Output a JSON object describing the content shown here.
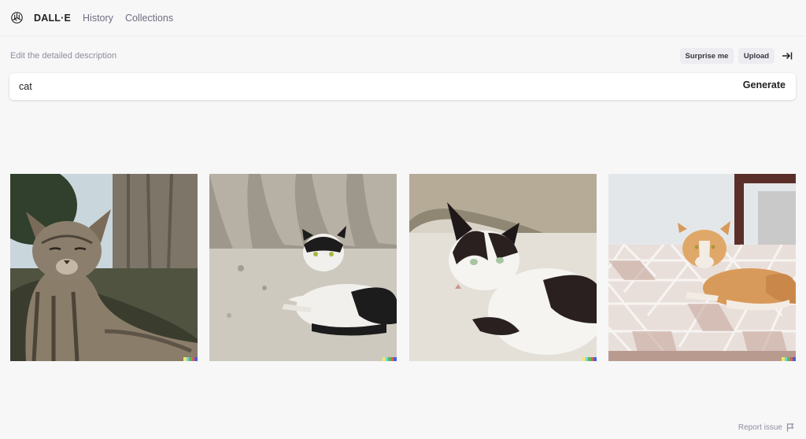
{
  "nav": {
    "brand": "DALL·E",
    "links": [
      "History",
      "Collections"
    ]
  },
  "editor": {
    "label": "Edit the detailed description",
    "surprise_label": "Surprise me",
    "upload_label": "Upload",
    "prompt_value": "cat",
    "generate_label": "Generate"
  },
  "footer": {
    "report_label": "Report issue"
  },
  "icons": {
    "logo": "openai-logo-icon",
    "collapse": "arrow-to-right-icon",
    "report": "flag-icon"
  },
  "colors": {
    "background": "#f7f7f8",
    "text_primary": "#202123",
    "text_secondary": "#6e6e80",
    "chip": "#ececf1",
    "signature": [
      "#f5e663",
      "#6bd5e1",
      "#5ab75a",
      "#e65a4a",
      "#4a5fd8"
    ]
  }
}
